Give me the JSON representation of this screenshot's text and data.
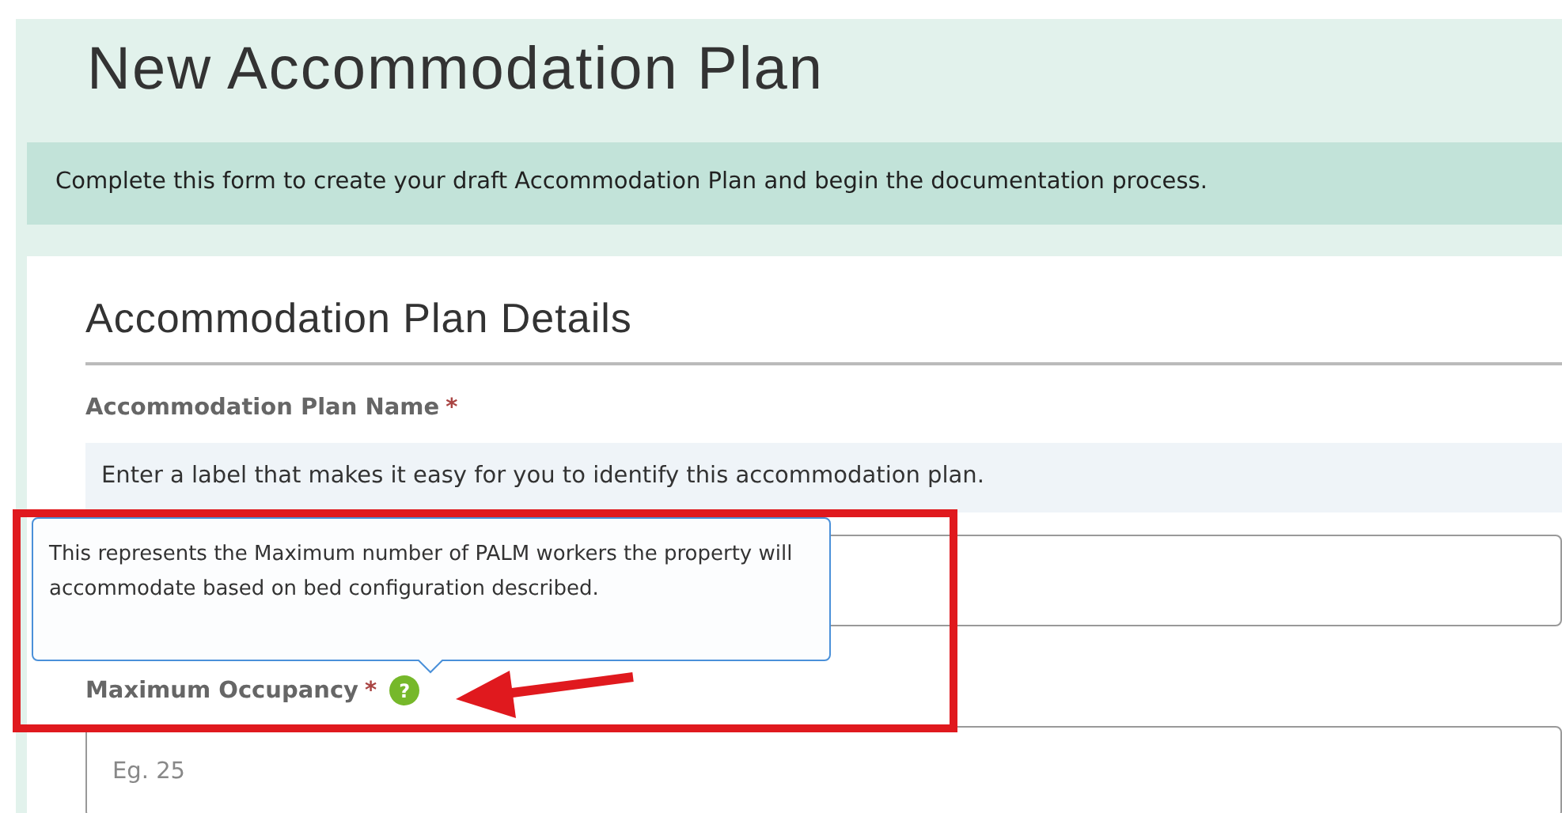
{
  "page": {
    "title": "New Accommodation Plan",
    "intro": "Complete this form to create your draft Accommodation Plan and begin the documentation process."
  },
  "section": {
    "title": "Accommodation Plan Details",
    "fields": [
      {
        "kind": "hinted",
        "label": "Accommodation Plan Name",
        "required_mark": "*",
        "hint": "Enter a label that makes it easy for you to identify this accommodation plan."
      },
      {
        "kind": "help",
        "label": "Maximum Occupancy",
        "required_mark": "*",
        "help_icon": "?",
        "placeholder": "Eg. 25"
      }
    ]
  },
  "tooltip": {
    "text": "This represents the Maximum number of PALM workers the property will accommodate based on bed configuration described."
  }
}
